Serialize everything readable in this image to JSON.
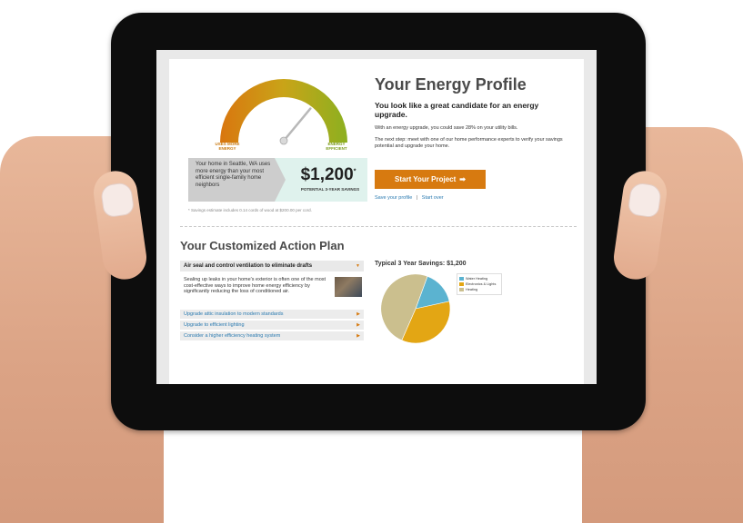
{
  "gauge": {
    "left_label": "USES MORE ENERGY",
    "right_label": "ENERGY EFFICIENT",
    "level": 0.72
  },
  "info_box": {
    "text": "Your home in Seattle, WA uses more energy than your most efficient single-family home neighbors"
  },
  "savings": {
    "amount": "$1,200",
    "marker": "*",
    "label": "POTENTIAL 3-YEAR SAVINGS"
  },
  "footnote": "* Savings estimate includes 0.14 cords of wood at $200.00 per cord.",
  "profile": {
    "title": "Your Energy Profile",
    "subtitle": "You look like a great candidate for an energy upgrade.",
    "text1": "With an energy upgrade, you could save 28% on your utility bills.",
    "text2": "The next step: meet with one of our home performance experts to verify your savings potential and upgrade your home.",
    "cta_label": "Start Your Project",
    "cta_icon": "arrow-right-icon",
    "link_save": "Save your profile",
    "link_separator": "|",
    "link_start_over": "Start over"
  },
  "plan": {
    "title": "Your Customized Action Plan",
    "open_item": {
      "title": "Air seal and control ventilation to eliminate drafts",
      "description": "Sealing up leaks in your home's exterior is often one of the most cost-effective ways to improve home energy efficiency by significantly reducing the loss of conditioned air."
    },
    "items": [
      {
        "label": "Upgrade attic insulation to modern standards"
      },
      {
        "label": "Upgrade to efficient lighting"
      },
      {
        "label": "Consider a higher efficiency heating system"
      }
    ]
  },
  "colors": {
    "accent": "#d77a10",
    "link": "#2a7ab0",
    "savings_bg": "#dff2ed",
    "water_heating": "#5bb3d0",
    "electronics_lights": "#e3a614",
    "heating": "#cbbf8e"
  },
  "chart_data": {
    "type": "pie",
    "title": "Typical 3 Year Savings: $1,200",
    "categories": [
      "Water Heating",
      "Electronics & Lights",
      "Heating"
    ],
    "values": [
      0.16,
      0.35,
      0.49
    ],
    "legend": "right"
  }
}
